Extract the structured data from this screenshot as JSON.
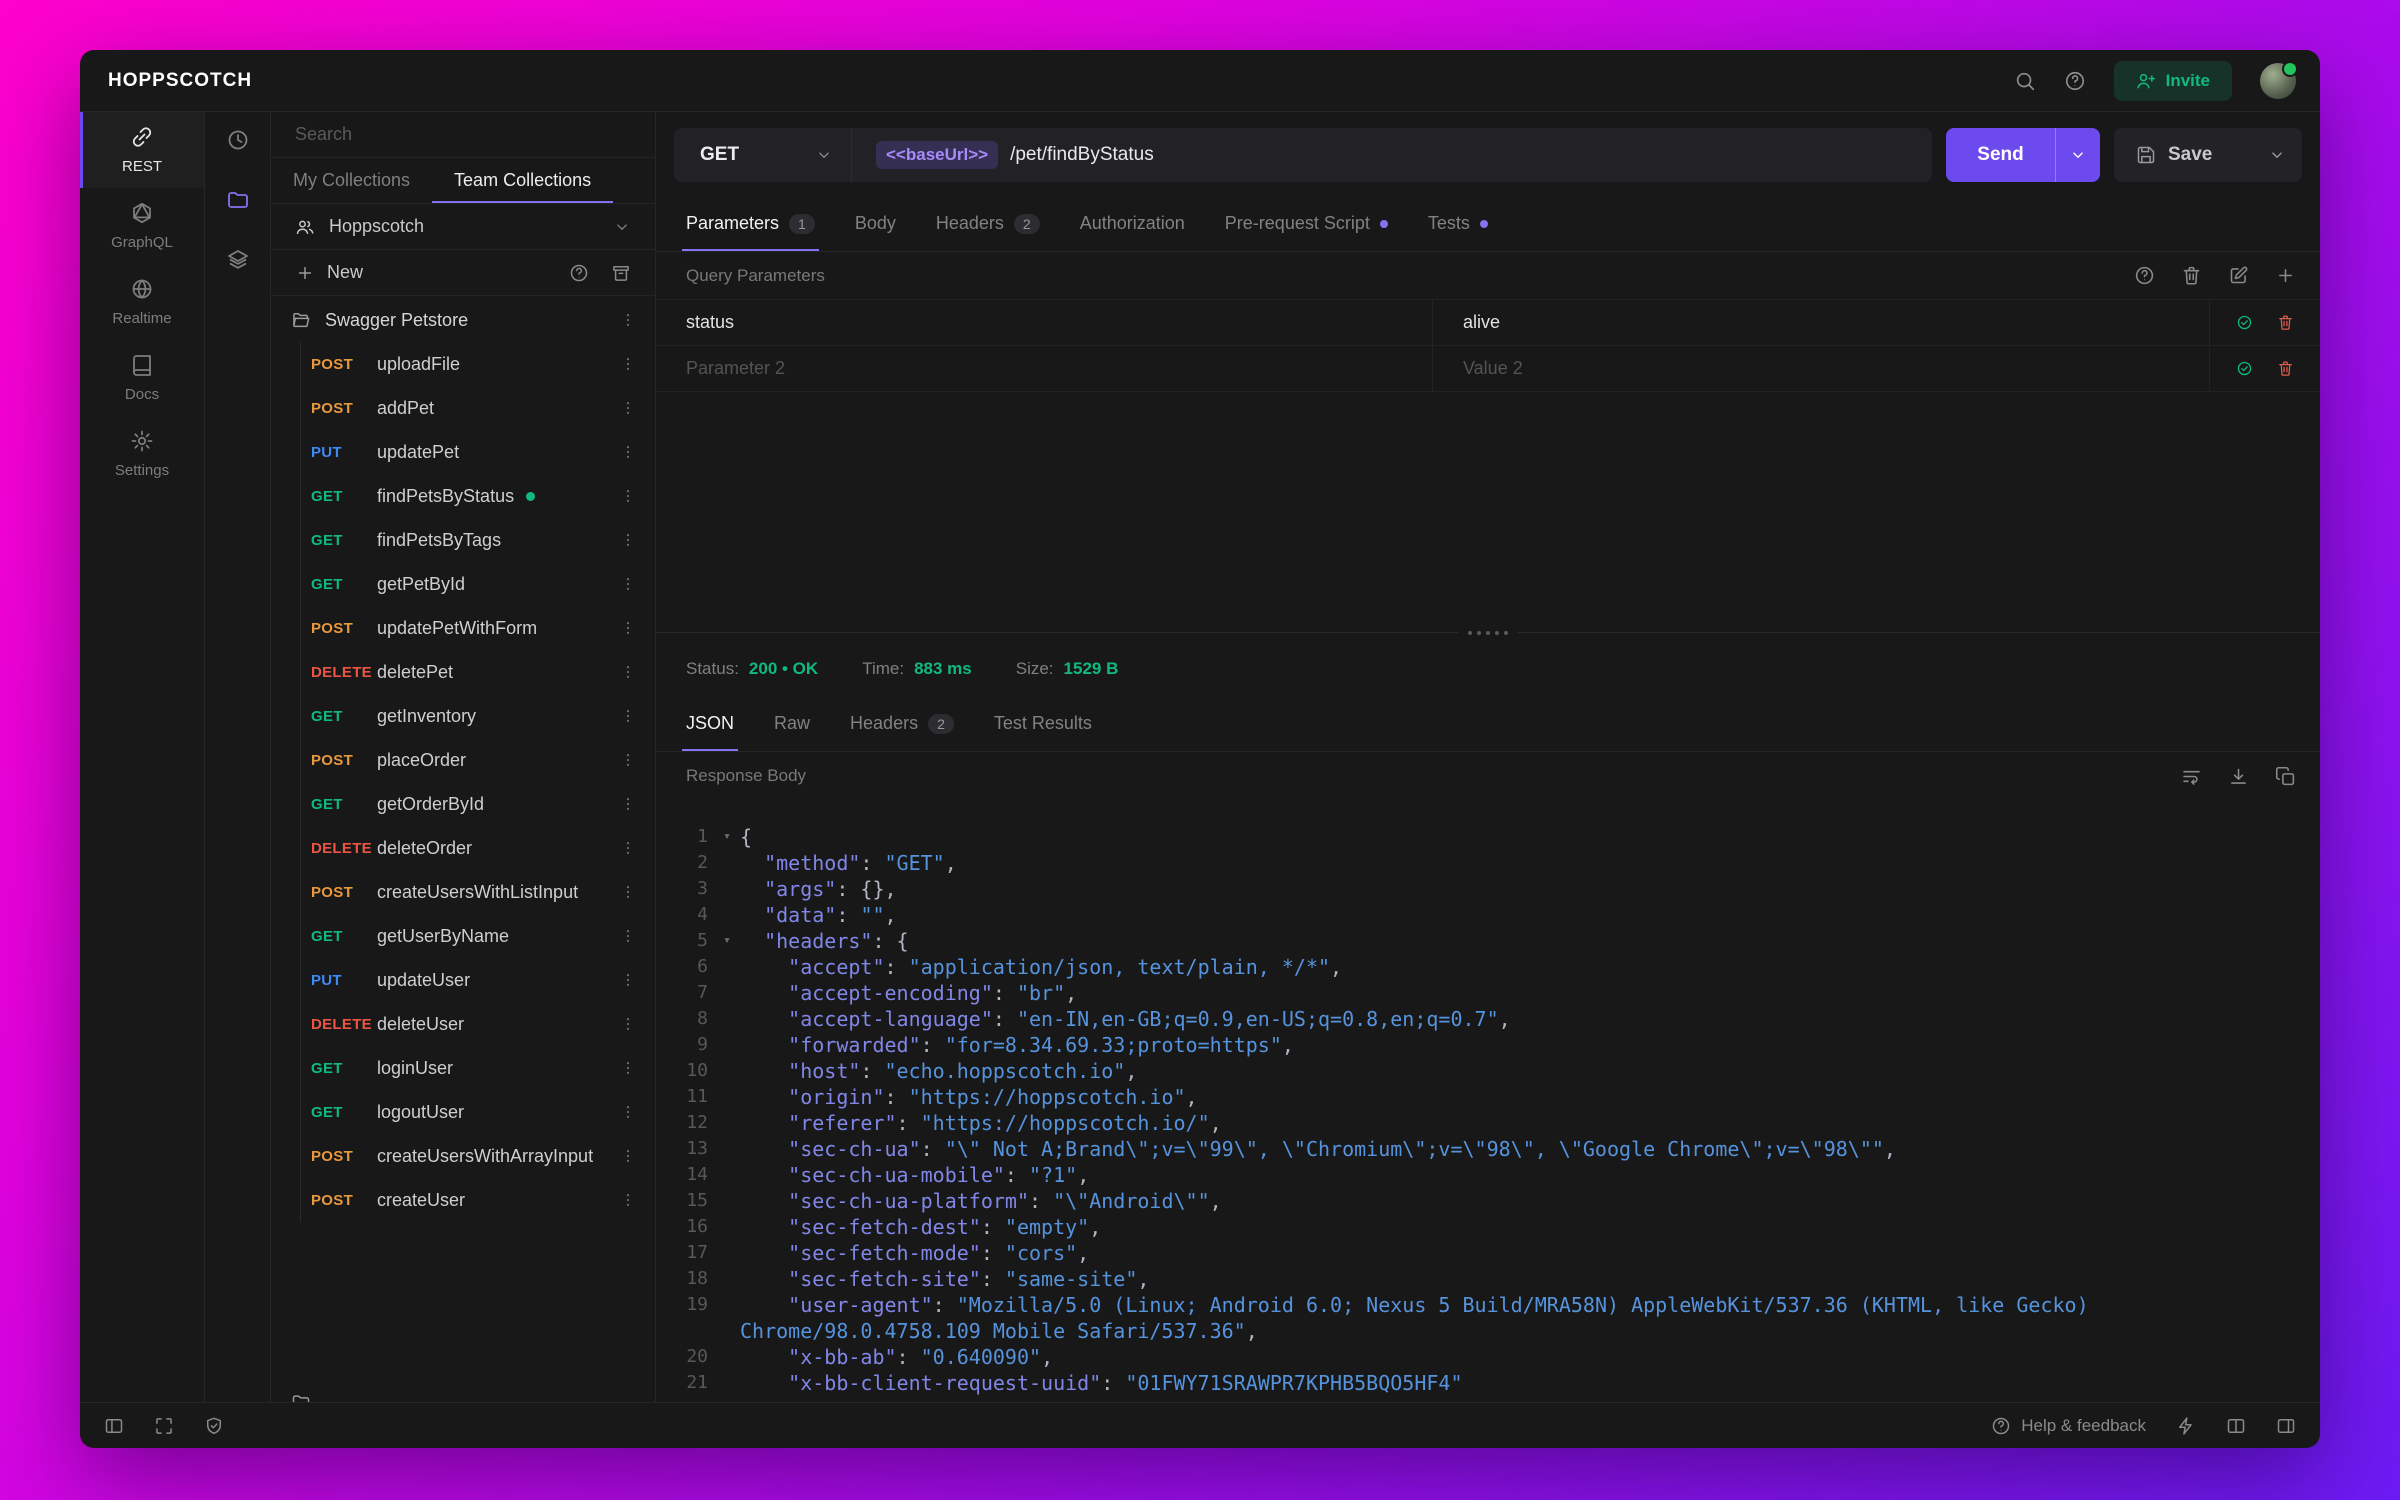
{
  "colors": {
    "accent": "#6d4aed",
    "accent-soft": "#8273f0",
    "method-get": "#10b981",
    "method-post": "#e8983f",
    "method-put": "#4189f5",
    "method-delete": "#eb5545",
    "success": "#10b981",
    "danger": "#e05d4d"
  },
  "topbar": {
    "logo": "HOPPSCOTCH",
    "invite": "Invite"
  },
  "primary_nav": [
    {
      "id": "rest",
      "label": "REST",
      "icon": "link-icon",
      "active": true
    },
    {
      "id": "graphql",
      "label": "GraphQL",
      "icon": "graphql-icon"
    },
    {
      "id": "realtime",
      "label": "Realtime",
      "icon": "globe-icon"
    },
    {
      "id": "docs",
      "label": "Docs",
      "icon": "book-icon"
    },
    {
      "id": "settings",
      "label": "Settings",
      "icon": "gear-icon"
    }
  ],
  "collections": {
    "search_placeholder": "Search",
    "tabs": [
      {
        "label": "My Collections"
      },
      {
        "label": "Team Collections",
        "active": true
      }
    ],
    "team": "Hoppscotch",
    "new_label": "New",
    "folder": "Swagger Petstore",
    "requests": [
      {
        "method": "POST",
        "name": "uploadFile"
      },
      {
        "method": "POST",
        "name": "addPet"
      },
      {
        "method": "PUT",
        "name": "updatePet"
      },
      {
        "method": "GET",
        "name": "findPetsByStatus",
        "active": true
      },
      {
        "method": "GET",
        "name": "findPetsByTags"
      },
      {
        "method": "GET",
        "name": "getPetById"
      },
      {
        "method": "POST",
        "name": "updatePetWithForm"
      },
      {
        "method": "DELETE",
        "name": "deletePet"
      },
      {
        "method": "GET",
        "name": "getInventory"
      },
      {
        "method": "POST",
        "name": "placeOrder"
      },
      {
        "method": "GET",
        "name": "getOrderById"
      },
      {
        "method": "DELETE",
        "name": "deleteOrder"
      },
      {
        "method": "POST",
        "name": "createUsersWithListInput"
      },
      {
        "method": "GET",
        "name": "getUserByName"
      },
      {
        "method": "PUT",
        "name": "updateUser"
      },
      {
        "method": "DELETE",
        "name": "deleteUser"
      },
      {
        "method": "GET",
        "name": "loginUser"
      },
      {
        "method": "GET",
        "name": "logoutUser"
      },
      {
        "method": "POST",
        "name": "createUsersWithArrayInput"
      },
      {
        "method": "POST",
        "name": "createUser"
      }
    ]
  },
  "request": {
    "method": "GET",
    "url_token": "<<baseUrl>>",
    "url_path": "/pet/findByStatus",
    "send": "Send",
    "save": "Save",
    "tabs": [
      {
        "label": "Parameters",
        "badge": "1",
        "active": true
      },
      {
        "label": "Body"
      },
      {
        "label": "Headers",
        "badge": "2"
      },
      {
        "label": "Authorization"
      },
      {
        "label": "Pre-request Script",
        "dot": true
      },
      {
        "label": "Tests",
        "dot": true
      }
    ],
    "section_title": "Query Parameters",
    "params": [
      {
        "key": "status",
        "value": "alive"
      },
      {
        "key": "",
        "value": "",
        "key_placeholder": "Parameter 2",
        "value_placeholder": "Value 2"
      }
    ]
  },
  "response": {
    "meta": [
      {
        "label": "Status:",
        "value": "200 • OK"
      },
      {
        "label": "Time:",
        "value": "883 ms"
      },
      {
        "label": "Size:",
        "value": "1529 B"
      }
    ],
    "tabs": [
      {
        "label": "JSON",
        "active": true
      },
      {
        "label": "Raw"
      },
      {
        "label": "Headers",
        "badge": "2"
      },
      {
        "label": "Test Results"
      }
    ],
    "body_title": "Response Body",
    "code": [
      {
        "n": 1,
        "fold": true,
        "parts": [
          {
            "c": "p",
            "t": "{"
          }
        ]
      },
      {
        "n": 2,
        "parts": [
          {
            "c": "k",
            "t": "  \"method\""
          },
          {
            "c": "p",
            "t": ": "
          },
          {
            "c": "s",
            "t": "\"GET\""
          },
          {
            "c": "p",
            "t": ","
          }
        ]
      },
      {
        "n": 3,
        "parts": [
          {
            "c": "k",
            "t": "  \"args\""
          },
          {
            "c": "p",
            "t": ": {},"
          }
        ]
      },
      {
        "n": 4,
        "parts": [
          {
            "c": "k",
            "t": "  \"data\""
          },
          {
            "c": "p",
            "t": ": "
          },
          {
            "c": "s",
            "t": "\"\""
          },
          {
            "c": "p",
            "t": ","
          }
        ]
      },
      {
        "n": 5,
        "fold": true,
        "parts": [
          {
            "c": "k",
            "t": "  \"headers\""
          },
          {
            "c": "p",
            "t": ": {"
          }
        ]
      },
      {
        "n": 6,
        "parts": [
          {
            "c": "k",
            "t": "    \"accept\""
          },
          {
            "c": "p",
            "t": ": "
          },
          {
            "c": "s",
            "t": "\"application/json, text/plain, */*\""
          },
          {
            "c": "p",
            "t": ","
          }
        ]
      },
      {
        "n": 7,
        "parts": [
          {
            "c": "k",
            "t": "    \"accept-encoding\""
          },
          {
            "c": "p",
            "t": ": "
          },
          {
            "c": "s",
            "t": "\"br\""
          },
          {
            "c": "p",
            "t": ","
          }
        ]
      },
      {
        "n": 8,
        "parts": [
          {
            "c": "k",
            "t": "    \"accept-language\""
          },
          {
            "c": "p",
            "t": ": "
          },
          {
            "c": "s",
            "t": "\"en-IN,en-GB;q=0.9,en-US;q=0.8,en;q=0.7\""
          },
          {
            "c": "p",
            "t": ","
          }
        ]
      },
      {
        "n": 9,
        "parts": [
          {
            "c": "k",
            "t": "    \"forwarded\""
          },
          {
            "c": "p",
            "t": ": "
          },
          {
            "c": "s",
            "t": "\"for=8.34.69.33;proto=https\""
          },
          {
            "c": "p",
            "t": ","
          }
        ]
      },
      {
        "n": 10,
        "parts": [
          {
            "c": "k",
            "t": "    \"host\""
          },
          {
            "c": "p",
            "t": ": "
          },
          {
            "c": "s",
            "t": "\"echo.hoppscotch.io\""
          },
          {
            "c": "p",
            "t": ","
          }
        ]
      },
      {
        "n": 11,
        "parts": [
          {
            "c": "k",
            "t": "    \"origin\""
          },
          {
            "c": "p",
            "t": ": "
          },
          {
            "c": "s",
            "t": "\"https://hoppscotch.io\""
          },
          {
            "c": "p",
            "t": ","
          }
        ]
      },
      {
        "n": 12,
        "parts": [
          {
            "c": "k",
            "t": "    \"referer\""
          },
          {
            "c": "p",
            "t": ": "
          },
          {
            "c": "s",
            "t": "\"https://hoppscotch.io/\""
          },
          {
            "c": "p",
            "t": ","
          }
        ]
      },
      {
        "n": 13,
        "parts": [
          {
            "c": "k",
            "t": "    \"sec-ch-ua\""
          },
          {
            "c": "p",
            "t": ": "
          },
          {
            "c": "s",
            "t": "\"\\\" Not A;Brand\\\";v=\\\"99\\\", \\\"Chromium\\\";v=\\\"98\\\", \\\"Google Chrome\\\";v=\\\"98\\\"\""
          },
          {
            "c": "p",
            "t": ","
          }
        ]
      },
      {
        "n": 14,
        "parts": [
          {
            "c": "k",
            "t": "    \"sec-ch-ua-mobile\""
          },
          {
            "c": "p",
            "t": ": "
          },
          {
            "c": "s",
            "t": "\"?1\""
          },
          {
            "c": "p",
            "t": ","
          }
        ]
      },
      {
        "n": 15,
        "parts": [
          {
            "c": "k",
            "t": "    \"sec-ch-ua-platform\""
          },
          {
            "c": "p",
            "t": ": "
          },
          {
            "c": "s",
            "t": "\"\\\"Android\\\"\""
          },
          {
            "c": "p",
            "t": ","
          }
        ]
      },
      {
        "n": 16,
        "parts": [
          {
            "c": "k",
            "t": "    \"sec-fetch-dest\""
          },
          {
            "c": "p",
            "t": ": "
          },
          {
            "c": "s",
            "t": "\"empty\""
          },
          {
            "c": "p",
            "t": ","
          }
        ]
      },
      {
        "n": 17,
        "parts": [
          {
            "c": "k",
            "t": "    \"sec-fetch-mode\""
          },
          {
            "c": "p",
            "t": ": "
          },
          {
            "c": "s",
            "t": "\"cors\""
          },
          {
            "c": "p",
            "t": ","
          }
        ]
      },
      {
        "n": 18,
        "parts": [
          {
            "c": "k",
            "t": "    \"sec-fetch-site\""
          },
          {
            "c": "p",
            "t": ": "
          },
          {
            "c": "s",
            "t": "\"same-site\""
          },
          {
            "c": "p",
            "t": ","
          }
        ]
      },
      {
        "n": 19,
        "parts": [
          {
            "c": "k",
            "t": "    \"user-agent\""
          },
          {
            "c": "p",
            "t": ": "
          },
          {
            "c": "s",
            "t": "\"Mozilla/5.0 (Linux; Android 6.0; Nexus 5 Build/MRA58N) AppleWebKit/537.36 (KHTML, like Gecko) Chrome/98.0.4758.109 Mobile Safari/537.36\""
          },
          {
            "c": "p",
            "t": ","
          }
        ]
      },
      {
        "n": 20,
        "parts": [
          {
            "c": "k",
            "t": "    \"x-bb-ab\""
          },
          {
            "c": "p",
            "t": ": "
          },
          {
            "c": "s",
            "t": "\"0.640090\""
          },
          {
            "c": "p",
            "t": ","
          }
        ]
      },
      {
        "n": 21,
        "parts": [
          {
            "c": "k",
            "t": "    \"x-bb-client-request-uuid\""
          },
          {
            "c": "p",
            "t": ": "
          },
          {
            "c": "s",
            "t": "\"01FWY71SRAWPR7KPHB5BQO5HF4\""
          }
        ]
      }
    ]
  },
  "footer": {
    "help": "Help & feedback"
  }
}
